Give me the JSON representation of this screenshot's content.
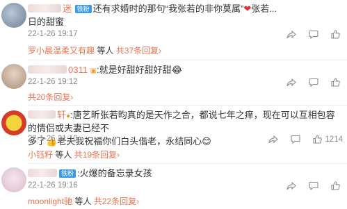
{
  "comments": [
    {
      "username_suffix": "迷",
      "badge": "铁粉",
      "text": "还有求婚时的那句“我张若的非你莫属”",
      "text2": "张若...",
      "line2": "日的甜蜜",
      "date": "22-1-26 19:17",
      "like_count": "",
      "reply_user": "罗小晨温柔又有趣",
      "reply_mid": " 等人 ",
      "reply_count": "共37条回复",
      "reply_arrow": "›"
    },
    {
      "username_suffix": "0311",
      "text": "就是好甜好甜好甜",
      "date": "22-1-26 19:12",
      "like_count": "",
      "reply_count": "共20条回复",
      "reply_arrow": "›"
    },
    {
      "username_suffix": "轩",
      "text": "唐艺昕张若昀真的是天作之合，都说七年之痒，现在可以互相包容的情侣或夫妻已经不",
      "line2_pre": "多了",
      "line2": "老夫我祝福你们白头偕老，永结同心",
      "date": "22-1-26 21:10",
      "like_count": "1214",
      "reply_user": "小钰籽",
      "reply_mid": " 等人 ",
      "reply_count": "共19条回复",
      "reply_arrow": "›"
    },
    {
      "username_suffix": "",
      "badge": "铁粉",
      "text": "火爆的备忘录女孩",
      "date": "22-1-26 19:16",
      "like_count": "",
      "reply_user": "moonlight驰",
      "reply_mid": " 等人 ",
      "reply_count": "共22条回复",
      "reply_arrow": "›"
    }
  ],
  "icons": {
    "reply": "reply-icon",
    "share": "share-icon",
    "like": "thumbs-up-icon"
  },
  "colors": {
    "accent": "#eb7350",
    "meta": "#8a8a8a",
    "badge": "#3a9ae8"
  }
}
